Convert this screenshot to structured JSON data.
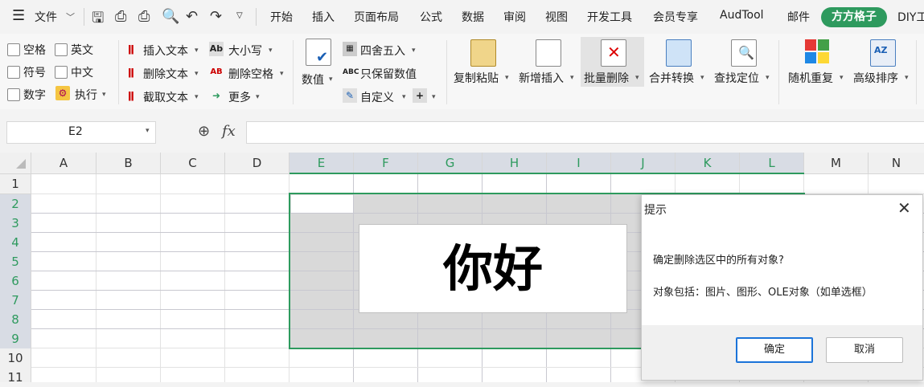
{
  "menubar": {
    "file_label": "文件",
    "tabs": [
      "开始",
      "插入",
      "页面布局",
      "公式",
      "数据",
      "审阅",
      "视图",
      "开发工具",
      "会员专享",
      "AudTool",
      "邮件",
      "方方格子",
      "DIY工具箱"
    ],
    "active_tab": "方方格子"
  },
  "ribbon": {
    "checkboxes": [
      "空格",
      "英文",
      "符号",
      "中文",
      "数字"
    ],
    "exec_label": "执行",
    "text_tools": [
      "插入文本",
      "删除文本",
      "截取文本"
    ],
    "case_tools": [
      "大小写",
      "删除空格",
      "更多"
    ],
    "value_label": "数值",
    "number_tools": [
      "四舍五入",
      "只保留数值",
      "自定义"
    ],
    "big_buttons": [
      "复制粘贴",
      "新增插入",
      "批量删除",
      "合并转换",
      "查找定位",
      "随机重复",
      "高级排序"
    ]
  },
  "formula_bar": {
    "cell_ref": "E2",
    "formula_value": ""
  },
  "sheet": {
    "columns": [
      "A",
      "B",
      "C",
      "D",
      "E",
      "F",
      "G",
      "H",
      "I",
      "J",
      "K",
      "L",
      "M",
      "N"
    ],
    "selected_columns": [
      "E",
      "F",
      "G",
      "H",
      "I",
      "J",
      "K",
      "L"
    ],
    "rows": [
      "1",
      "2",
      "3",
      "4",
      "5",
      "6",
      "7",
      "8",
      "9",
      "10",
      "11"
    ],
    "selected_rows": [
      "2",
      "3",
      "4",
      "5",
      "6",
      "7",
      "8",
      "9"
    ],
    "textbox_text": "你好"
  },
  "dialog": {
    "title": "提示",
    "message": "确定删除选区中的所有对象?",
    "detail": "对象包括：图片、图形、OLE对象（如单选框）",
    "ok_label": "确定",
    "cancel_label": "取消"
  },
  "colors": {
    "accent": "#2e9a5e",
    "selection": "#d9d9d9",
    "header_selected": "#d8dce4"
  }
}
